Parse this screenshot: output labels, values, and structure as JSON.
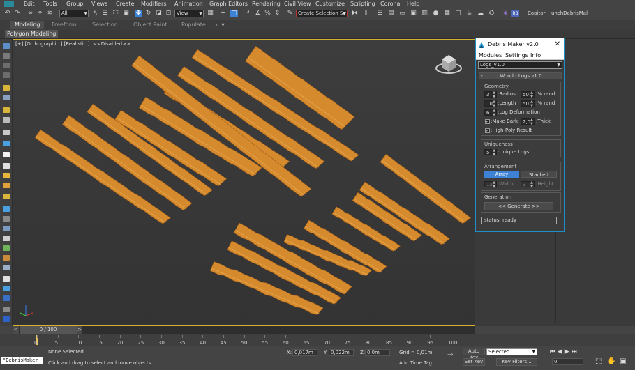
{
  "menu": {
    "items": [
      "Edit",
      "Tools",
      "Group",
      "Views",
      "Create",
      "Modifiers",
      "Animation",
      "Graph Editors",
      "Rendering",
      "Civil View",
      "Customize",
      "Scripting",
      "Corona",
      "Help"
    ]
  },
  "toolbar": {
    "filter_select": "All",
    "view_select": "View",
    "selection_set": "Create Selection Se",
    "copilot_label": "Copitor",
    "tab_label": "unchDebrisMal"
  },
  "ribbon": {
    "tabs": [
      "Modeling",
      "Freeform",
      "Selection",
      "Object Paint",
      "Populate"
    ],
    "sub_tab": "Polygon Modeling"
  },
  "viewport": {
    "label": "[+] [Orthographic ] [Realistic ]  <<Disabled>>"
  },
  "dialog": {
    "title": "Debris Maker v2.0",
    "close": "✕",
    "menu": [
      "Modules",
      "Settings",
      "Info"
    ],
    "module_select": "Logs_v1.0",
    "rollout": {
      "minus": "-",
      "title": "Wood - Logs v1.0"
    },
    "geometry": {
      "title": "Geometry",
      "radius_value": "3",
      "radius_label": ":Radius",
      "radius_rand": "50",
      "radius_rand_label": ":% rand",
      "length_value": "10",
      "length_label": ":Length",
      "length_rand": "50",
      "length_rand_label": ":% rand",
      "deform_value": "6",
      "deform_label": ":Log Deformation",
      "make_bark_label": ":Make Bark",
      "make_bark_checked": true,
      "thick_value": "2,0",
      "thick_label": ":Thick",
      "high_poly_label": ":High-Poly Result",
      "high_poly_checked": true
    },
    "uniqueness": {
      "title": "Uniqueness",
      "value": "5",
      "label": ":Unique Logs"
    },
    "arrangement": {
      "title": "Arrangement",
      "array_label": "Array",
      "stacked_label": "Stacked",
      "width_value": "12",
      "width_label": ":Width",
      "height_value": "3",
      "height_label": ":Height"
    },
    "generation": {
      "title": "Generation",
      "button": "<< Generate >>"
    },
    "status": "status: ready"
  },
  "timeline": {
    "prev": "<",
    "position": "0 / 100",
    "next": ">",
    "ticks": [
      "0",
      "5",
      "10",
      "15",
      "20",
      "25",
      "30",
      "35",
      "40",
      "45",
      "50",
      "55",
      "60",
      "65",
      "70",
      "75",
      "80",
      "85",
      "90",
      "95",
      "100"
    ]
  },
  "statusbar": {
    "script_field": "\"DebrisMaker",
    "selection_status": "None Selected",
    "prompt": "Click and drag to select and move objects",
    "x_label": "X:",
    "x_value": "0,017m",
    "y_label": "Y:",
    "y_value": "0,022m",
    "z_label": "Z:",
    "z_value": "0,0m",
    "grid": "Grid = 0,01m",
    "add_time_tag": "Add Time Tag",
    "auto_key": "Auto Key",
    "set_key": "Set Key",
    "selected_select": "Selected",
    "key_filters": "Key Filters...",
    "frame_field": "0"
  },
  "colors": {
    "accent_blue": "#3d82d4",
    "viewport_border": "#d4b230",
    "wood": "#d68a2e",
    "dialog_border": "#1e90c7"
  }
}
